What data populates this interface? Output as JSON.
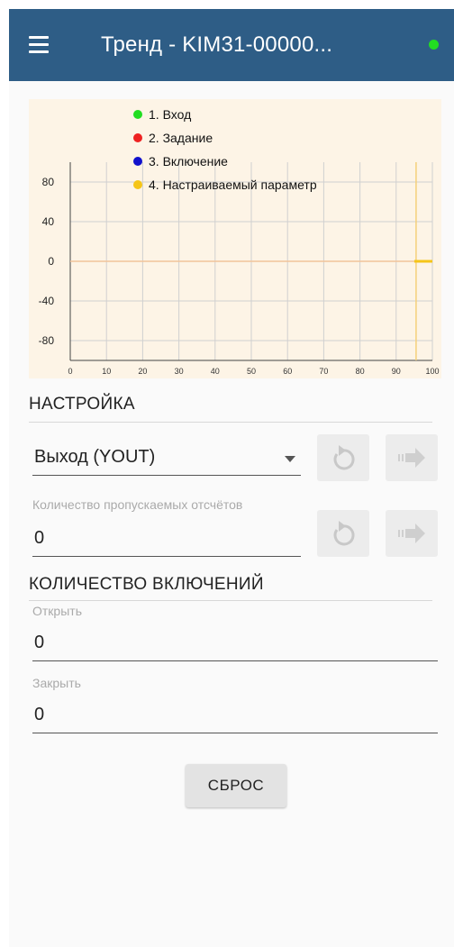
{
  "appbar": {
    "title": "Тренд - KIM31-00000...",
    "menu_icon": "hamburger-menu-icon",
    "status_color": "#22dd22",
    "background": "#2e5d86"
  },
  "chart_data": {
    "type": "line",
    "x_ticks": [
      "0",
      "10",
      "20",
      "30",
      "40",
      "50",
      "60",
      "70",
      "80",
      "90",
      "100"
    ],
    "y_ticks": [
      "80",
      "40",
      "0",
      "-40",
      "-80"
    ],
    "xlim": [
      0,
      100
    ],
    "ylim": [
      -100,
      100
    ],
    "grid": true,
    "legend_position": "top",
    "series": [
      {
        "name": "1. Вход",
        "color": "#22dd22",
        "x": [],
        "y": []
      },
      {
        "name": "2. Задание",
        "color": "#ee2222",
        "x": [],
        "y": []
      },
      {
        "name": "3. Включение",
        "color": "#1111cc",
        "x": [],
        "y": []
      },
      {
        "name": "4. Настраиваемый параметр",
        "color": "#f5c518",
        "x": [
          0,
          95,
          95,
          100
        ],
        "y": [
          0,
          0,
          0,
          0
        ]
      }
    ],
    "cursor_x": 95.5
  },
  "setup": {
    "title": "НАСТРОЙКА",
    "output_select": "Выход (YOUT)",
    "skip_label": "Количество пропускаемых отсчётов",
    "skip_value": "0"
  },
  "switching": {
    "title": "КОЛИЧЕСТВО ВКЛЮЧЕНИЙ",
    "open_label": "Открыть",
    "open_value": "0",
    "close_label": "Закрыть",
    "close_value": "0"
  },
  "reset_label": "СБРОС"
}
